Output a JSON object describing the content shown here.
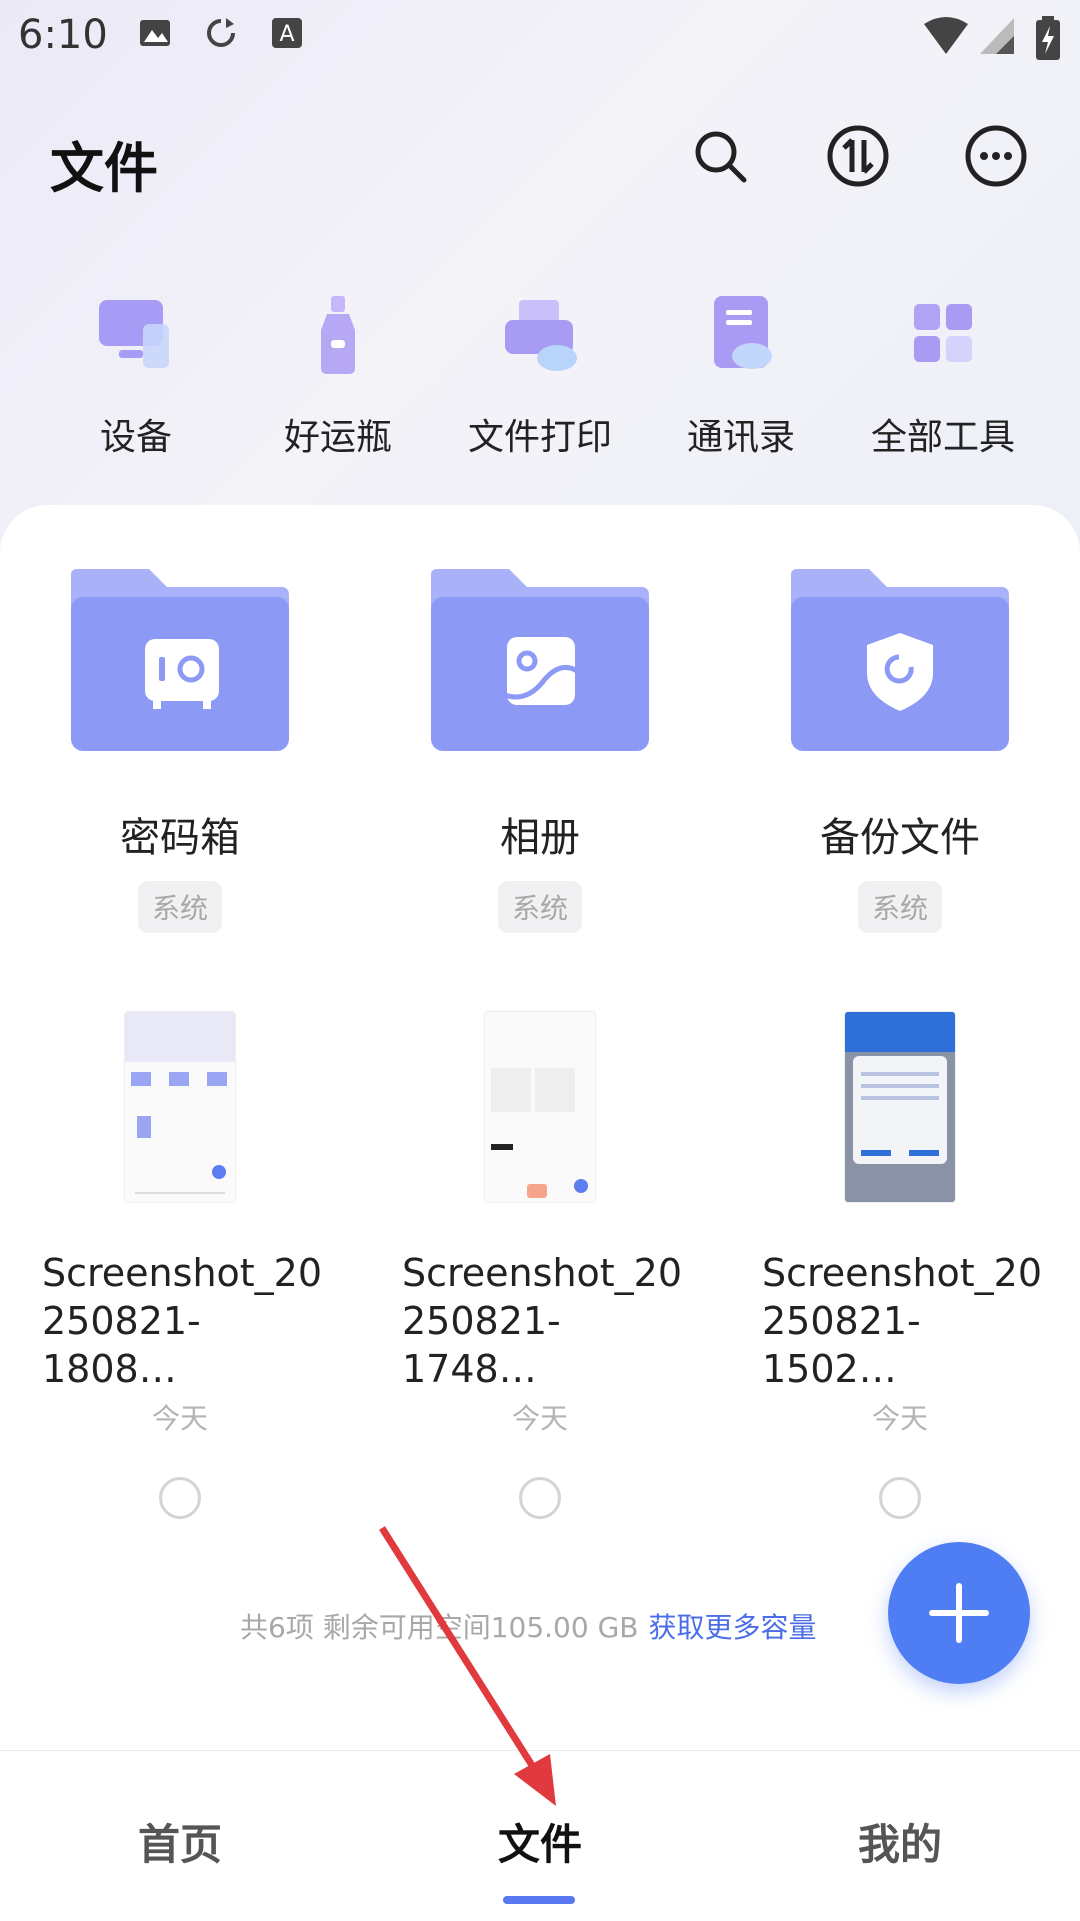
{
  "status_bar": {
    "time": "6:10"
  },
  "header": {
    "title": "文件"
  },
  "tools": [
    {
      "label": "设备",
      "icon": "monitor-icon"
    },
    {
      "label": "好运瓶",
      "icon": "bottle-icon"
    },
    {
      "label": "文件打印",
      "icon": "printer-icon"
    },
    {
      "label": "通讯录",
      "icon": "contacts-icon"
    },
    {
      "label": "全部工具",
      "icon": "grid-icon"
    }
  ],
  "folders": [
    {
      "name": "密码箱",
      "tag": "系统",
      "icon": "safe-icon"
    },
    {
      "name": "相册",
      "tag": "系统",
      "icon": "photo-icon"
    },
    {
      "name": "备份文件",
      "tag": "系统",
      "icon": "shield-icon"
    }
  ],
  "files": [
    {
      "name_line1": "Screenshot_20",
      "name_line2": "250821-1808…",
      "date": "今天"
    },
    {
      "name_line1": "Screenshot_20",
      "name_line2": "250821-1748…",
      "date": "今天"
    },
    {
      "name_line1": "Screenshot_20",
      "name_line2": "250821-1502…",
      "date": "今天"
    }
  ],
  "storage": {
    "summary": "共6项 剩余可用空间105.00 GB",
    "more_link": "获取更多容量"
  },
  "bottom_nav": {
    "home": "首页",
    "files": "文件",
    "mine": "我的"
  },
  "colors": {
    "accent": "#4f7df3",
    "folder": "#8b9af5",
    "arrow": "#e0393e"
  }
}
